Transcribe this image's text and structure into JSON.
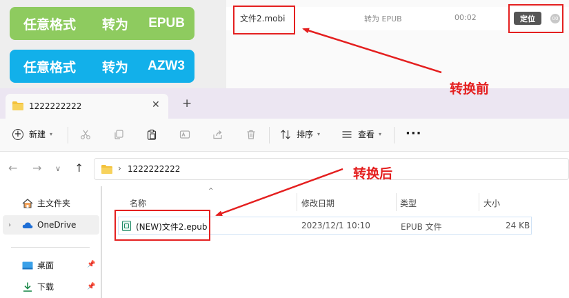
{
  "converter": {
    "buttons": [
      {
        "from": "任意格式",
        "to_word": "转为",
        "format": "EPUB",
        "color": "#8ecb5f"
      },
      {
        "from": "任意格式",
        "to_word": "转为",
        "format": "AZW3",
        "color": "#12b0ea"
      }
    ],
    "task": {
      "file_name": "文件2.mobi",
      "target": "转为 EPUB",
      "time": "00:02",
      "locate_label": "定位",
      "status_icon": "00"
    }
  },
  "explorer": {
    "tab": {
      "title": "1222222222",
      "close": "✕",
      "add": "+"
    },
    "toolbar": {
      "new_label": "新建",
      "sort_label": "排序",
      "view_label": "查看",
      "more_label": "···"
    },
    "address": {
      "separator": "›",
      "path": "1222222222"
    },
    "sidebar": {
      "items": [
        {
          "label": "主文件夹",
          "icon": "home-icon"
        },
        {
          "label": "OneDrive",
          "icon": "cloud-icon"
        },
        {
          "label": "桌面",
          "icon": "desktop-icon"
        },
        {
          "label": "下载",
          "icon": "download-icon"
        }
      ]
    },
    "columns": {
      "name": "名称",
      "date": "修改日期",
      "type": "类型",
      "size": "大小"
    },
    "files": [
      {
        "name": "(NEW)文件2.epub",
        "date": "2023/12/1 10:10",
        "type": "EPUB 文件",
        "size": "24 KB"
      }
    ]
  },
  "annotations": {
    "before": "转换前",
    "after": "转换后",
    "color": "#e41f1f"
  }
}
